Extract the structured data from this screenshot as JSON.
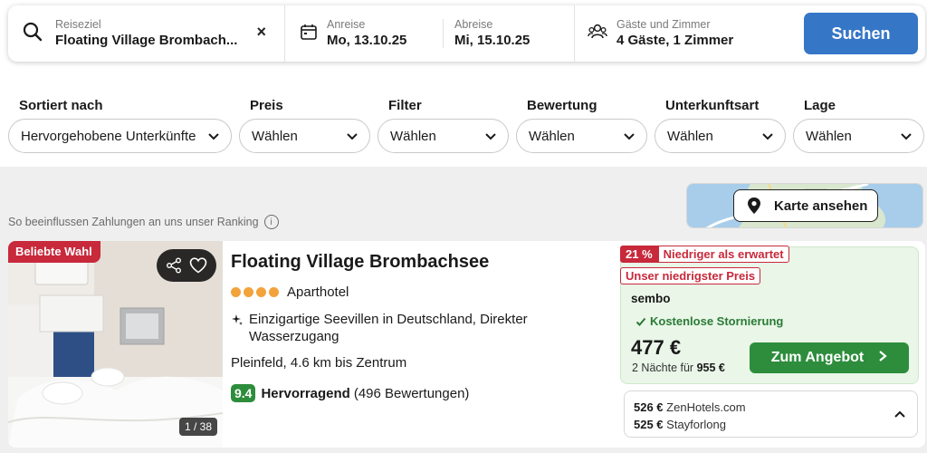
{
  "search": {
    "destination_label": "Reiseziel",
    "destination_value": "Floating Village Brombach...",
    "clear_icon": "×",
    "checkin_label": "Anreise",
    "checkin_value": "Mo, 13.10.25",
    "checkout_label": "Abreise",
    "checkout_value": "Mi, 15.10.25",
    "guests_label": "Gäste und Zimmer",
    "guests_value": "4 Gäste, 1 Zimmer",
    "submit_label": "Suchen",
    "accent_color": "#3576c7"
  },
  "filters": [
    {
      "label": "Sortiert nach",
      "value": "Hervorgehobene Unterkünfte"
    },
    {
      "label": "Preis",
      "value": "Wählen"
    },
    {
      "label": "Filter",
      "value": "Wählen"
    },
    {
      "label": "Bewertung",
      "value": "Wählen"
    },
    {
      "label": "Unterkunftsart",
      "value": "Wählen"
    },
    {
      "label": "Lage",
      "value": "Wählen"
    }
  ],
  "ranking_note": "So beeinflussen Zahlungen an uns unser Ranking",
  "map_button_label": "Karte ansehen",
  "result": {
    "popular_badge": "Beliebte Wahl",
    "photo_counter": "1 / 38",
    "name": "Floating Village Brombachsee",
    "star_count": 4,
    "type": "Aparthotel",
    "feature_line1": "Einzigartige Seevillen in Deutschland, Direkter",
    "feature_line2": "Wasserzugang",
    "location": "Pleinfeld, 4.6 km bis Zentrum",
    "score": "9.4",
    "score_word": "Hervorragend",
    "review_count": "(496 Bewertungen)",
    "deal": {
      "discount": "21 %",
      "discount_text": "Niedriger als erwartet",
      "lowest_tag": "Unser niedrigster Preis",
      "provider": "sembo",
      "cancellation": "Kostenlose Stornierung",
      "price": "477 €",
      "nights_text": "2 Nächte für",
      "total": "955 €",
      "cta": "Zum Angebot"
    },
    "other_offers": [
      {
        "price": "526 €",
        "site": "ZenHotels.com"
      },
      {
        "price": "525 €",
        "site": "Stayforlong"
      }
    ]
  },
  "colors": {
    "green": "#2d8d3c",
    "red": "#c8293b",
    "star_orange": "#f2a33c"
  }
}
